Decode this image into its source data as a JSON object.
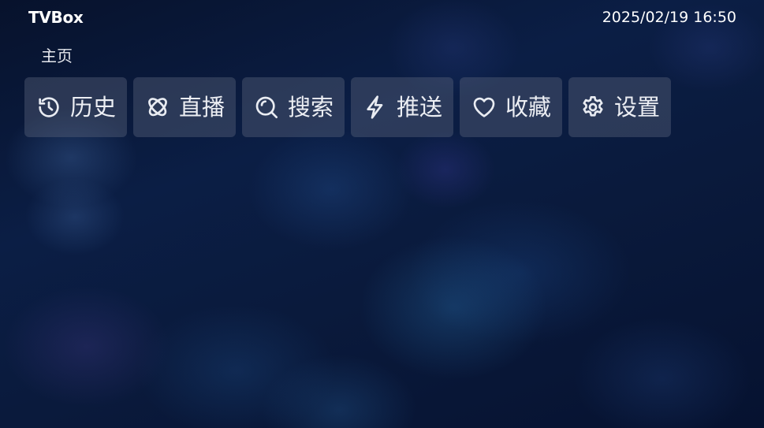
{
  "header": {
    "app_title": "TVBox",
    "datetime": "2025/02/19 16:50"
  },
  "breadcrumb": {
    "current": "主页"
  },
  "menu": {
    "items": [
      {
        "label": "历史",
        "icon": "history-icon"
      },
      {
        "label": "直播",
        "icon": "live-icon"
      },
      {
        "label": "搜索",
        "icon": "search-icon"
      },
      {
        "label": "推送",
        "icon": "lightning-icon"
      },
      {
        "label": "收藏",
        "icon": "heart-icon"
      },
      {
        "label": "设置",
        "icon": "gear-icon"
      }
    ]
  },
  "colors": {
    "background": "#0b1e45",
    "tile": "#5a647d",
    "text": "#ffffff"
  }
}
